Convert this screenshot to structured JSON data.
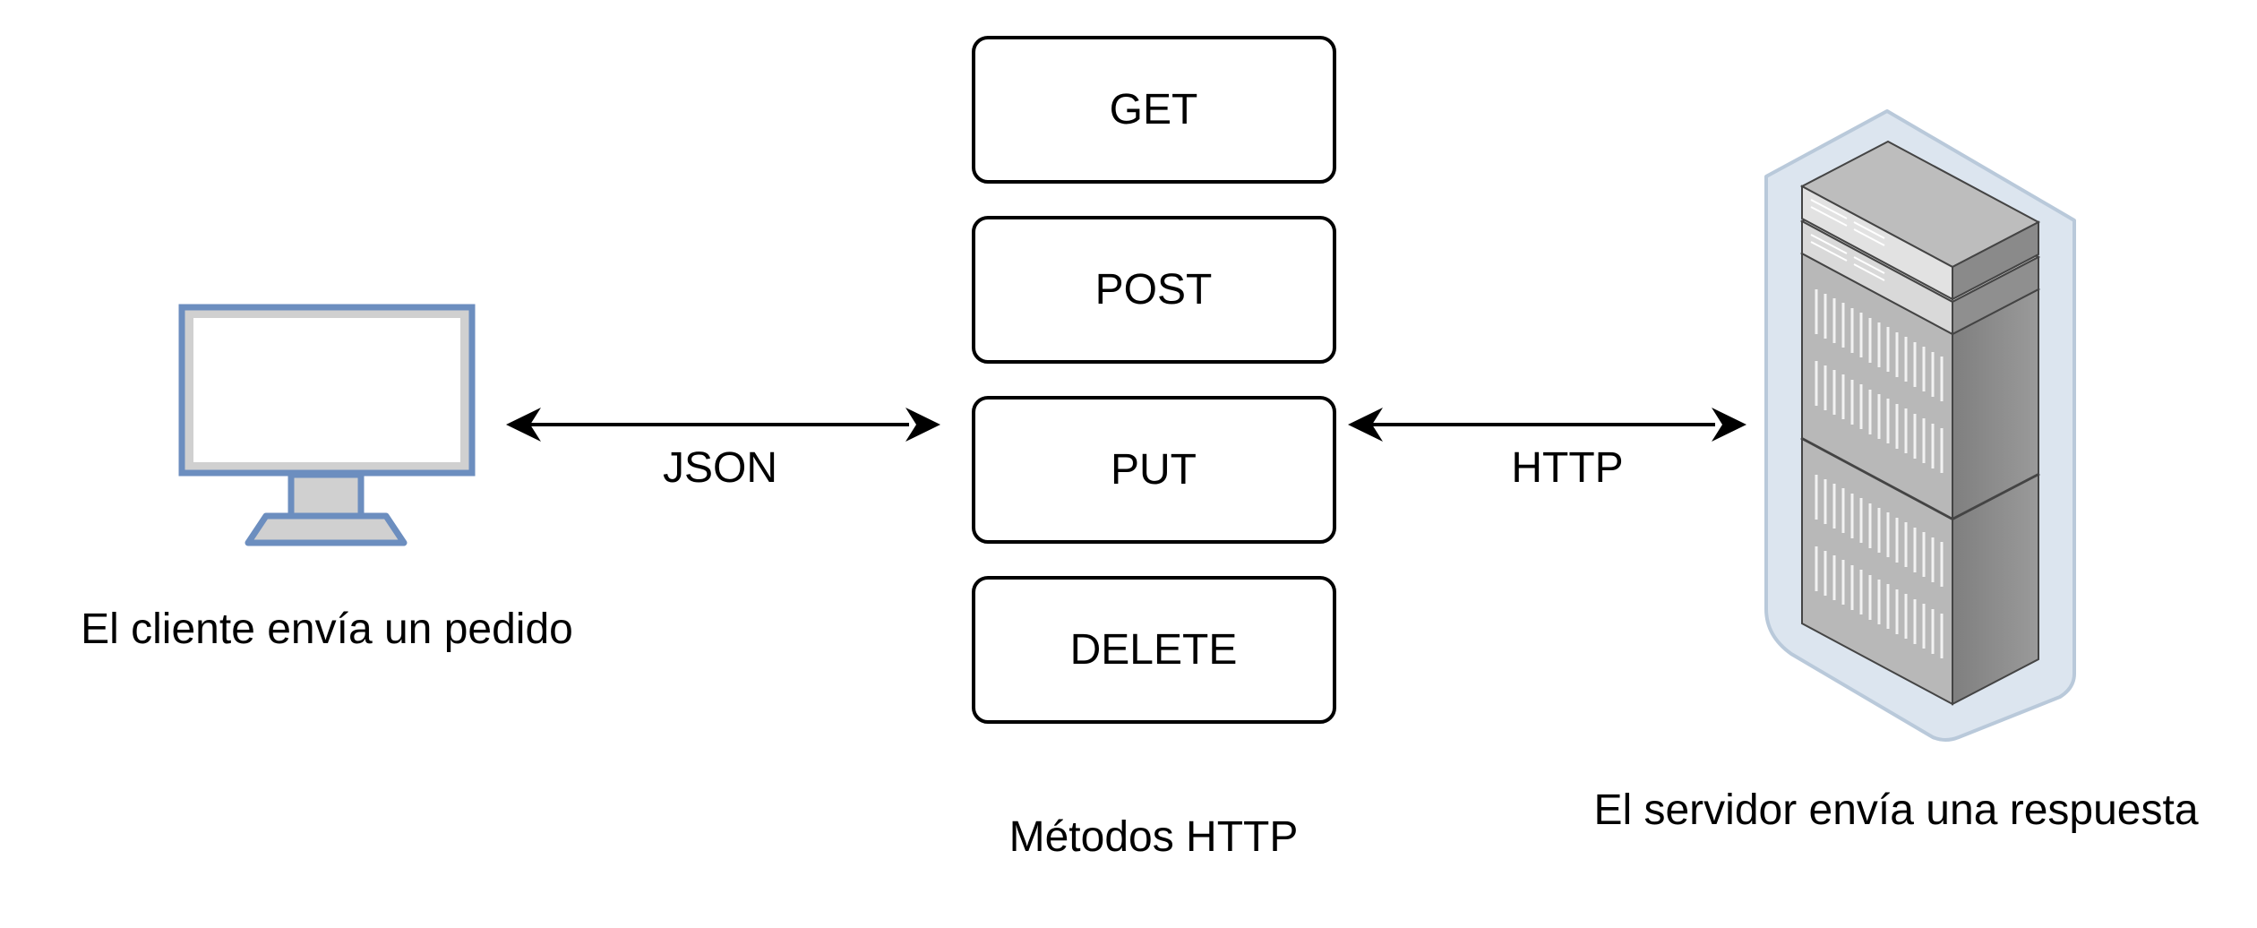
{
  "client": {
    "icon": "monitor-icon",
    "caption": "El cliente envía un pedido"
  },
  "methods": {
    "items": [
      "GET",
      "POST",
      "PUT",
      "DELETE"
    ],
    "caption": "Métodos HTTP"
  },
  "server": {
    "icon": "server-rack-icon",
    "caption": "El servidor envía una respuesta"
  },
  "connectors": {
    "client_to_methods": "JSON",
    "methods_to_server": "HTTP"
  },
  "colors": {
    "monitor_frame": "#6C8EBF",
    "monitor_fill": "#D0D0D0",
    "rack_bg": "#DCE5EF",
    "rack_bg_stroke": "#B9C9DA"
  }
}
